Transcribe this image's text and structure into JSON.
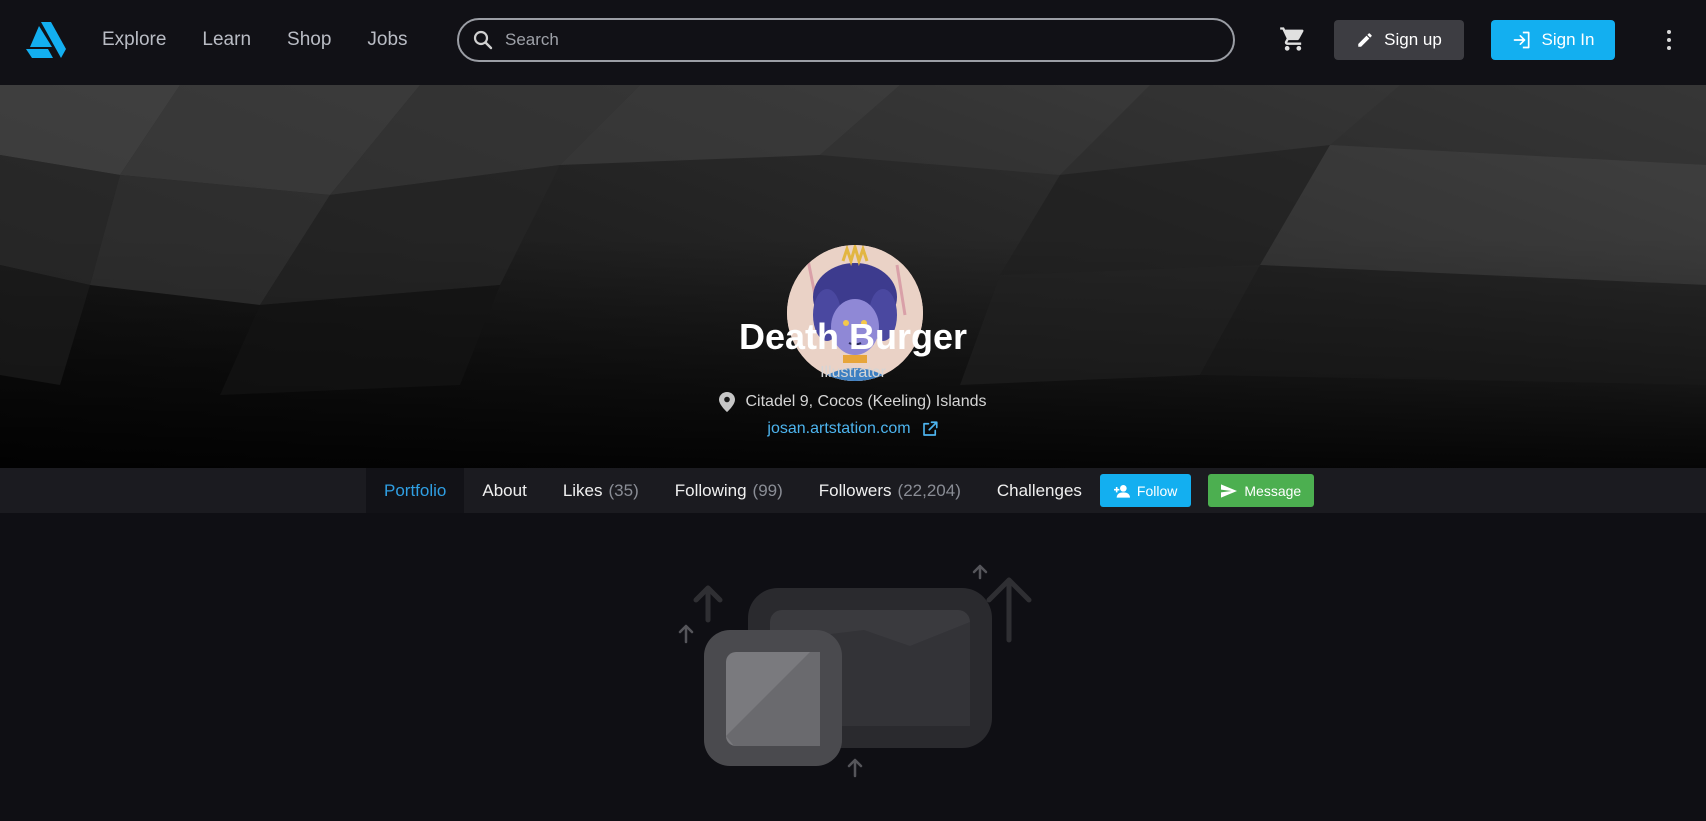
{
  "header": {
    "nav": [
      "Explore",
      "Learn",
      "Shop",
      "Jobs"
    ],
    "search_placeholder": "Search",
    "signup_label": "Sign up",
    "signin_label": "Sign In"
  },
  "profile": {
    "name": "Death Burger",
    "role": "Illustrator",
    "location": "Citadel 9, Cocos (Keeling) Islands",
    "website": "josan.artstation.com"
  },
  "tabs": [
    {
      "label": "Portfolio",
      "count": "",
      "active": true
    },
    {
      "label": "About",
      "count": ""
    },
    {
      "label": "Likes",
      "count": "(35)"
    },
    {
      "label": "Following",
      "count": "(99)"
    },
    {
      "label": "Followers",
      "count": "(22,204)"
    },
    {
      "label": "Challenges",
      "count": ""
    }
  ],
  "actions": {
    "follow_label": "Follow",
    "message_label": "Message"
  },
  "colors": {
    "accent": "#13aff0",
    "link": "#4db4ee",
    "message": "#4caf50",
    "background": "#0f0f14"
  },
  "icons": [
    "artstation-logo-icon",
    "search-icon",
    "cart-icon",
    "pencil-icon",
    "sign-in-icon",
    "more-vert-icon",
    "location-pin-icon",
    "external-link-icon",
    "add-user-icon",
    "send-icon",
    "empty-portfolio-icon"
  ]
}
